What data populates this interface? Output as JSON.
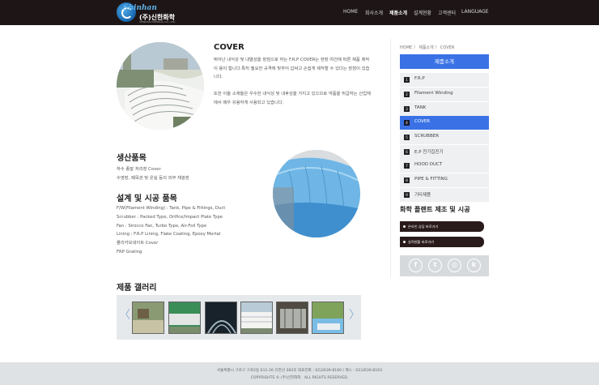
{
  "header": {
    "logo_en": "Shinhan",
    "logo_kr": "(주)신한화학",
    "logo_sub": "SHINHAN CHEMICAL CO., LTD.",
    "nav": [
      {
        "label": "HOME",
        "active": false
      },
      {
        "label": "회사소개",
        "active": false
      },
      {
        "label": "제품소개",
        "active": true
      },
      {
        "label": "설계현황",
        "active": false
      },
      {
        "label": "고객센터",
        "active": false
      },
      {
        "label": "LANGUAGE",
        "active": false
      }
    ]
  },
  "cover": {
    "title": "COVER",
    "desc1": "뛰어난 내식성 및 내열성을 장점으로 하는 F.R.P COVER는 현장 여건에 따른 제품 제작이 용이 합니다.특히 필요한 규격에 맞추어 갑싸고 손쉽게 제작할 수 있다는 장점이 있습니다.",
    "desc2": "또한 이들 소재들은 우수한 내식성 및 내후성을 가지고 있으므로 약품을 취급하는 산업체에서 매우 유용하게 사용되고 있습니다."
  },
  "products": {
    "title": "생산품목",
    "items": [
      "하수 종말 처리장 Cover",
      "수영장, 폐목관 및 온실 등의 외부 채광판"
    ]
  },
  "design": {
    "title": "설계 및 시공 품목",
    "items": [
      "F/W(Filament Winding) : Tank, Pipe & Fittings, Duct",
      "Scrubber : Packed Type, Orifice/Impact Plate Type",
      "Fan : Sirocco Fan, Turbo Type, Air-Foil Type",
      "Lining : F.R.P Lining, Flake Coating, Epoxy Mortal",
      "폴리카보네이트 Cover",
      "FRP Grating"
    ]
  },
  "gallery": {
    "title": "제품 갤러리",
    "prev": "〈",
    "next": "〉"
  },
  "sidebar": {
    "breadcrumb": "HOME 〉 제품소개 〉 COVER",
    "heading": "제품소개",
    "items": [
      {
        "num": "1",
        "label": "F.R.P",
        "active": false
      },
      {
        "num": "2",
        "label": "Filament Winding",
        "active": false
      },
      {
        "num": "3",
        "label": "TANK",
        "active": false
      },
      {
        "num": "4",
        "label": "COVER",
        "active": true
      },
      {
        "num": "5",
        "label": "SCRUBBER",
        "active": false
      },
      {
        "num": "6",
        "label": "E.P 전기집진기",
        "active": false
      },
      {
        "num": "7",
        "label": "HOOD DUCT",
        "active": false
      },
      {
        "num": "8",
        "label": "PIPE & FITTING",
        "active": false
      },
      {
        "num": "9",
        "label": "기타제품",
        "active": false
      }
    ],
    "chem_title": "화학 플랜트 제조 및 시공",
    "pills": [
      "온라인 상담 바로가기",
      "실적현황 바로가기"
    ],
    "social": [
      {
        "name": "facebook-icon",
        "glyph": "f"
      },
      {
        "name": "twitter-icon",
        "glyph": "t"
      },
      {
        "name": "instagram-icon",
        "glyph": "◎"
      },
      {
        "name": "kakao-icon",
        "glyph": "k"
      }
    ]
  },
  "footer": {
    "line1": "서울특별시 구로구 구로2동 611-26 유한산 383호   대표전화 : 02)2639-8160 / 팩스 : 02)2639-8163",
    "line2": "COPYRIGHTS © (주)신한화학 . ALL RIGHTS RESERVED."
  },
  "colors": {
    "header_bg": "#1e1616",
    "accent_blue": "#3a72e6",
    "pill_bg": "#2a1b1b",
    "footer_bg": "#dfe2e5"
  }
}
